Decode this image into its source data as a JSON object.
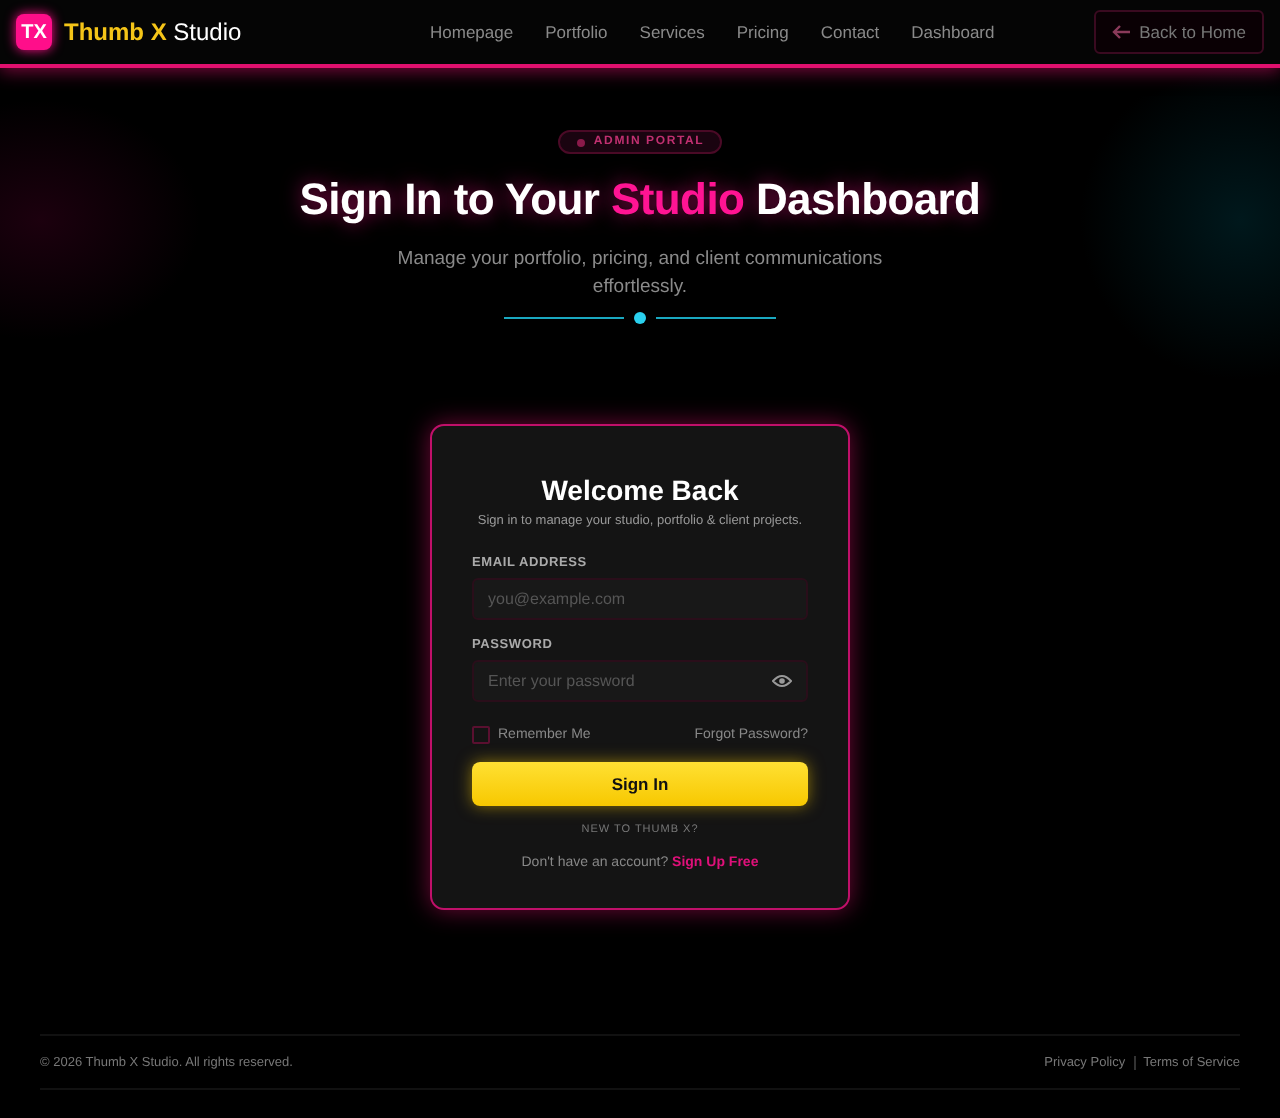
{
  "brand": {
    "logo": "TX",
    "accent": "Thumb X",
    "rest": "Studio"
  },
  "nav": [
    "Homepage",
    "Portfolio",
    "Services",
    "Pricing",
    "Contact",
    "Dashboard"
  ],
  "back_button": "Back to Home",
  "hero": {
    "badge": "ADMIN PORTAL",
    "title_before": "Sign In to Your",
    "title_accent": "Studio",
    "title_after": "Dashboard",
    "subtitle": "Manage your portfolio, pricing, and client communications effortlessly."
  },
  "card": {
    "title": "Welcome Back",
    "subtitle": "Sign in to manage your studio, portfolio & client projects.",
    "email": {
      "label": "EMAIL ADDRESS",
      "placeholder": "you@example.com"
    },
    "password": {
      "label": "PASSWORD",
      "placeholder": "Enter your password"
    },
    "remember": {
      "label": "Remember Me",
      "checked": false
    },
    "forgot": "Forgot Password?",
    "submit": "Sign In",
    "new_label": "NEW TO THUMB X?",
    "signup_text": "Don't have an account?",
    "signup_link": "Sign Up Free"
  },
  "footer": {
    "copyright": "© 2026 Thumb X Studio. All rights reserved.",
    "links": [
      "Privacy Policy",
      "Terms of Service"
    ]
  }
}
